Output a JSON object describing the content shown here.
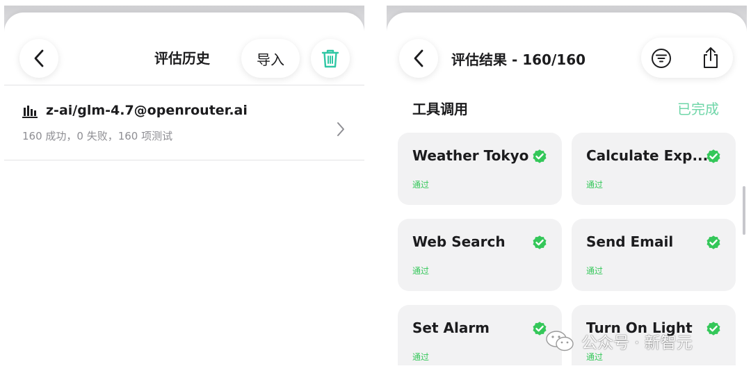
{
  "left": {
    "header": {
      "title": "评估历史",
      "import_label": "导入"
    },
    "history": [
      {
        "model": "z-ai/glm-4.7@openrouter.ai",
        "summary": "160 成功，0 失败，160 项测试"
      }
    ],
    "colors": {
      "trash": "#2fc7a4"
    }
  },
  "right": {
    "header": {
      "title": "评估结果 - 160/160"
    },
    "section": {
      "title": "工具调用",
      "status": "已完成"
    },
    "cards": [
      {
        "name": "Weather Tokyo",
        "status": "通过"
      },
      {
        "name": "Calculate Exp...",
        "status": "通过"
      },
      {
        "name": "Web Search",
        "status": "通过"
      },
      {
        "name": "Send Email",
        "status": "通过"
      },
      {
        "name": "Set Alarm",
        "status": "通过"
      },
      {
        "name": "Turn On Light",
        "status": "通过"
      }
    ],
    "colors": {
      "accent": "#34c759",
      "section_status": "#6fd6a8"
    }
  },
  "watermark": {
    "text": "公众号 · 新智元"
  },
  "icons": [
    "back-chevron-icon",
    "trash-icon",
    "bar-chart-icon",
    "chevron-right-icon",
    "filter-icon",
    "share-icon",
    "check-badge-icon",
    "wechat-icon"
  ]
}
